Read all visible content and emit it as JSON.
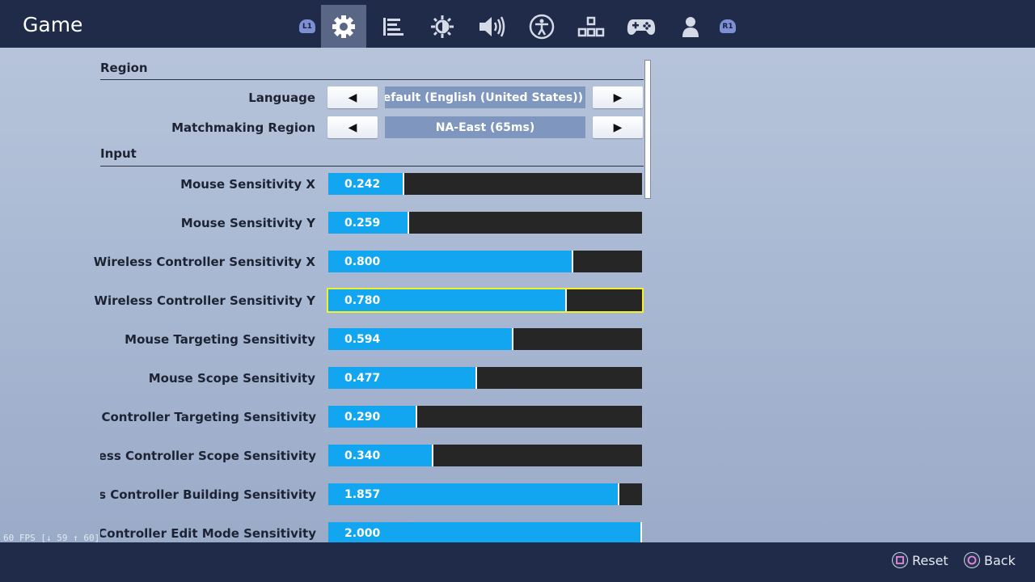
{
  "header": {
    "title": "Game",
    "left_shoulder": "L1",
    "right_shoulder": "R1",
    "tabs": [
      {
        "name": "game",
        "icon": "gear-icon",
        "active": true
      },
      {
        "name": "video",
        "icon": "video-list-icon"
      },
      {
        "name": "brightness",
        "icon": "brightness-icon"
      },
      {
        "name": "audio",
        "icon": "speaker-icon"
      },
      {
        "name": "accessibility",
        "icon": "accessibility-icon"
      },
      {
        "name": "input",
        "icon": "key-layout-icon"
      },
      {
        "name": "controller",
        "icon": "gamepad-icon"
      },
      {
        "name": "account",
        "icon": "person-icon"
      }
    ]
  },
  "region": {
    "title": "Region",
    "language": {
      "label": "Language",
      "value": "n Default (English (United States))"
    },
    "matchmaking": {
      "label": "Matchmaking Region",
      "value": "NA-East (65ms)"
    }
  },
  "input": {
    "title": "Input",
    "sliders": [
      {
        "label": "Mouse Sensitivity X",
        "value": "0.242",
        "fraction": 0.236
      },
      {
        "label": "Mouse Sensitivity Y",
        "value": "0.259",
        "fraction": 0.253
      },
      {
        "label": "Wireless Controller Sensitivity X",
        "value": "0.800",
        "fraction": 0.775
      },
      {
        "label": "Wireless Controller Sensitivity Y",
        "value": "0.780",
        "fraction": 0.755
      },
      {
        "label": "Mouse Targeting Sensitivity",
        "value": "0.594",
        "fraction": 0.585
      },
      {
        "label": "Mouse Scope Sensitivity",
        "value": "0.477",
        "fraction": 0.468
      },
      {
        "label": "Wireless Controller Targeting Sensitivity",
        "value": "0.290",
        "fraction": 0.278
      },
      {
        "label": "Wireless Controller Scope Sensitivity",
        "value": "0.340",
        "fraction": 0.33
      },
      {
        "label": "Wireless Controller Building Sensitivity",
        "value": "1.857",
        "fraction": 0.923
      },
      {
        "label": "Wireless Controller Edit Mode Sensitivity",
        "value": "2.000",
        "fraction": 0.995
      }
    ]
  },
  "fps": "60 FPS [↓ 59 ↑ 60]",
  "footer": {
    "reset": "Reset",
    "back": "Back"
  },
  "colors": {
    "accent_fill": "#11a6ef",
    "selected_outline": "#f4f02a",
    "header_bg": "#1f2b49"
  }
}
